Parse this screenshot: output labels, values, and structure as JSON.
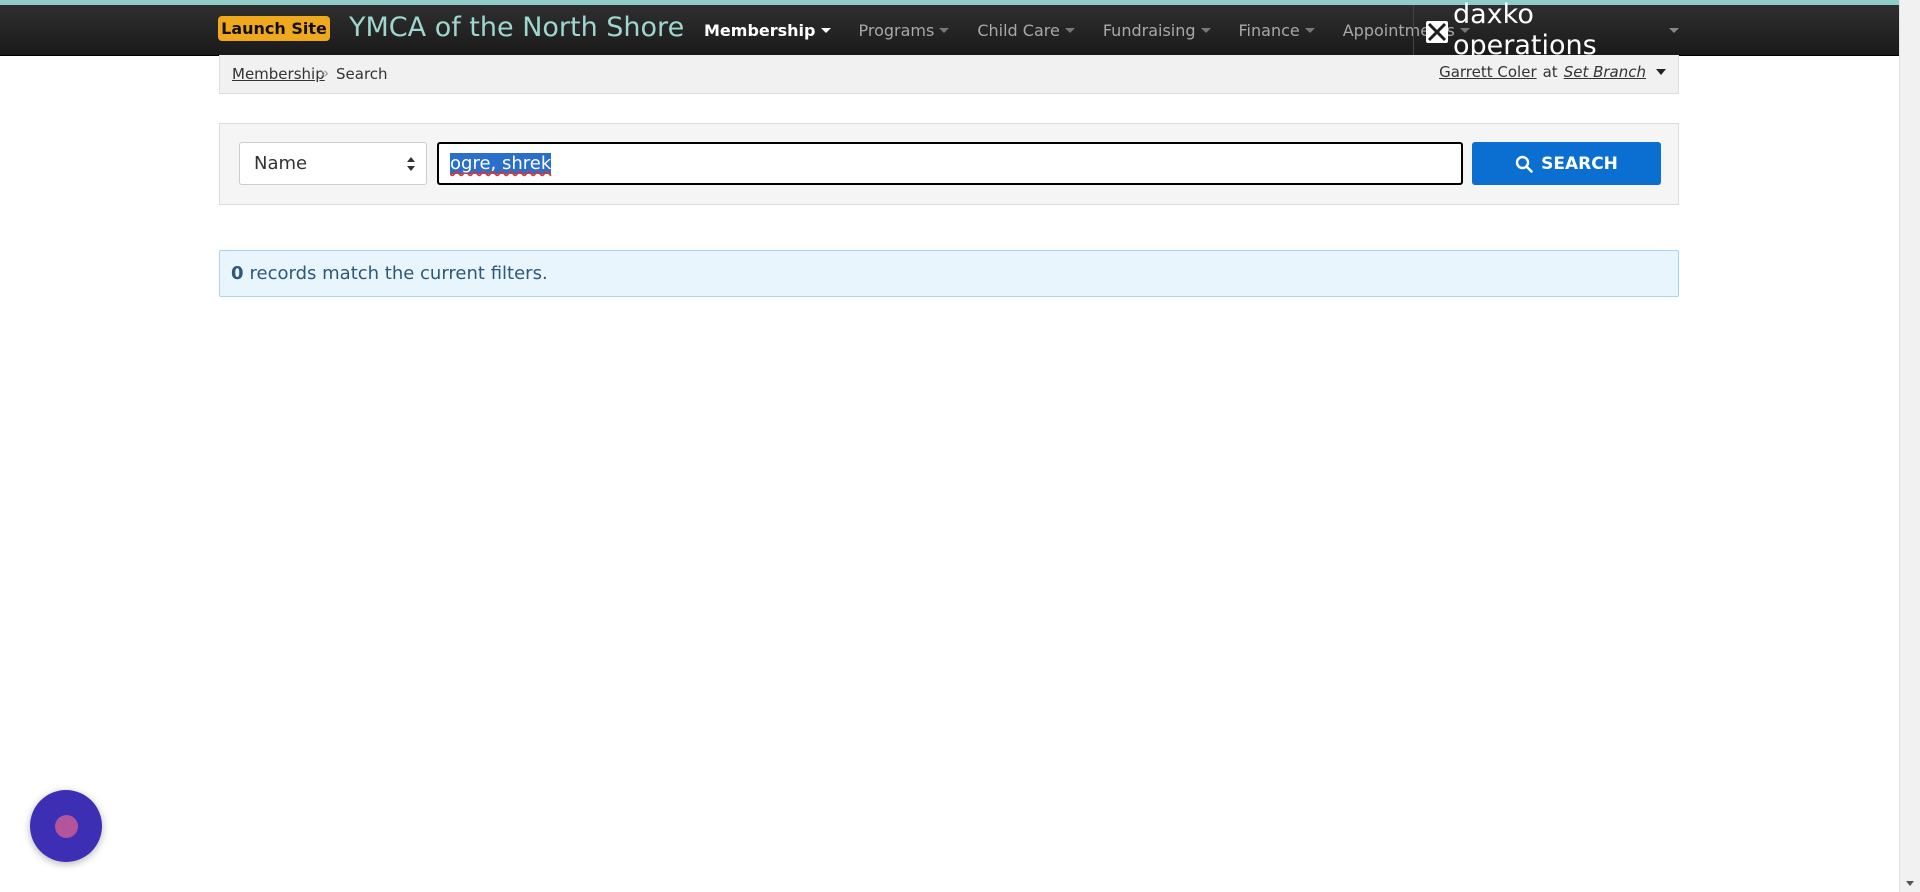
{
  "navbar": {
    "launch_site_label": "Launch Site",
    "site_title": "YMCA of the North Shore",
    "items": [
      {
        "label": "Membership",
        "active": true
      },
      {
        "label": "Programs",
        "active": false
      },
      {
        "label": "Child Care",
        "active": false
      },
      {
        "label": "Fundraising",
        "active": false
      },
      {
        "label": "Finance",
        "active": false
      },
      {
        "label": "Appointments",
        "active": false
      }
    ],
    "brand": "daxko operations"
  },
  "breadcrumb": {
    "parent": "Membership",
    "separator": "»",
    "current": "Search"
  },
  "user": {
    "name": "Garrett Coler",
    "at": "at",
    "branch": "Set Branch"
  },
  "search": {
    "field_type": "Name",
    "query": "ogre, shrek",
    "button_label": "SEARCH"
  },
  "results": {
    "count": "0",
    "message": "records match the current filters."
  },
  "colors": {
    "accent": "#0b6fd1",
    "launch": "#f0a81c",
    "title": "#9fd6cf"
  }
}
